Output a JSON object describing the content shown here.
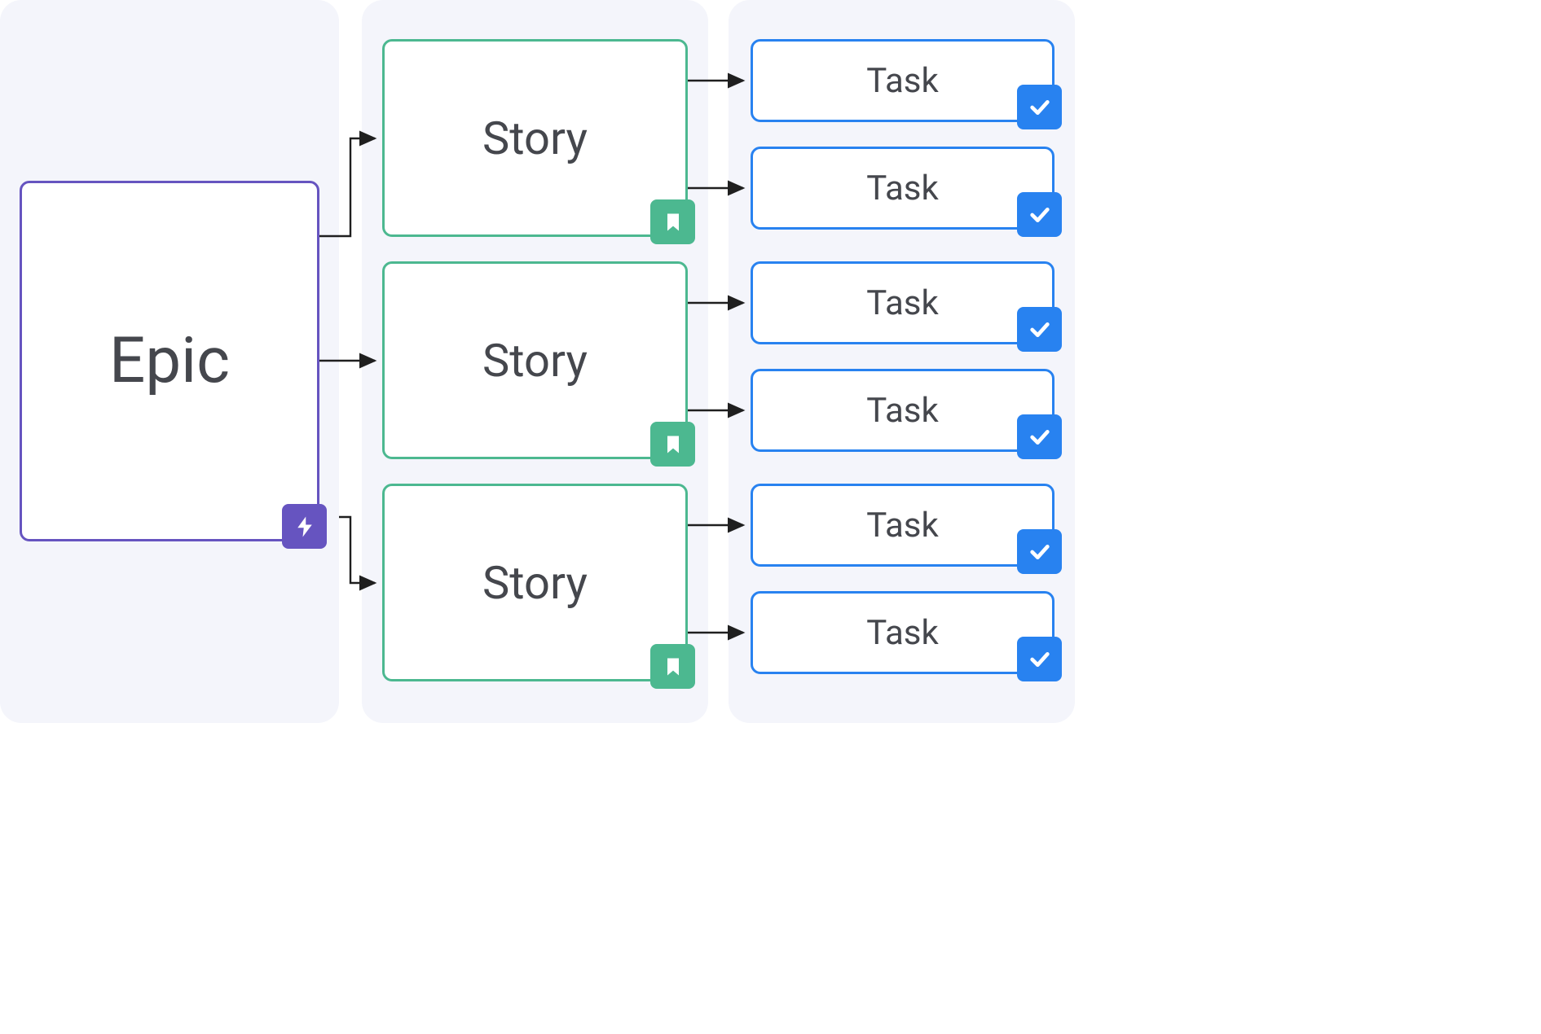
{
  "colors": {
    "epic": "#6654c0",
    "story": "#4cb890",
    "task": "#2882f0",
    "panel": "#f4f5fb",
    "text": "#45474d"
  },
  "epic": {
    "label": "Epic"
  },
  "stories": [
    {
      "label": "Story"
    },
    {
      "label": "Story"
    },
    {
      "label": "Story"
    }
  ],
  "tasks": [
    {
      "label": "Task"
    },
    {
      "label": "Task"
    },
    {
      "label": "Task"
    },
    {
      "label": "Task"
    },
    {
      "label": "Task"
    },
    {
      "label": "Task"
    }
  ],
  "icons": {
    "epic": "lightning-icon",
    "story": "bookmark-icon",
    "task": "check-icon"
  }
}
